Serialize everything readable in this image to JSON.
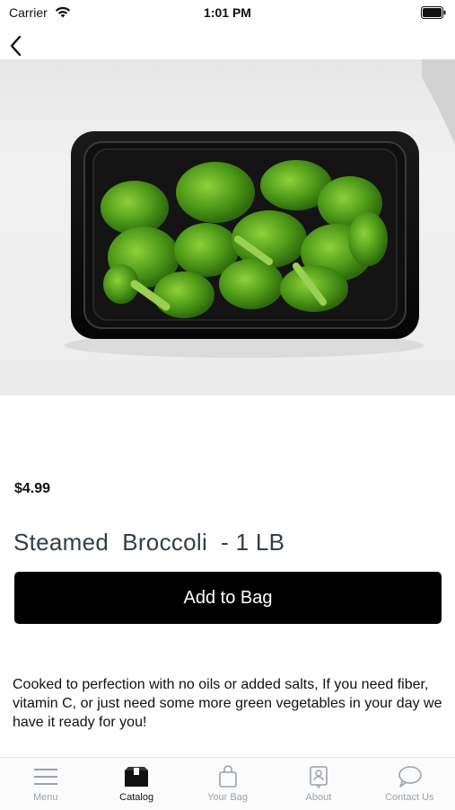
{
  "status_bar": {
    "carrier": "Carrier",
    "time": "1:01 PM"
  },
  "product": {
    "image_icon": "steamed-broccoli-photo",
    "price": "$4.99",
    "title": "Steamed  Broccoli  - 1 LB",
    "add_button_label": "Add to Bag",
    "description": "Cooked to perfection with no oils or added salts, If you need fiber, vitamin C, or just need some more green vegetables in your day we have it ready for you!"
  },
  "tab_bar": {
    "tabs": [
      {
        "label": "Menu",
        "icon": "menu-icon",
        "active": false
      },
      {
        "label": "Catalog",
        "icon": "catalog-icon",
        "active": true
      },
      {
        "label": "Your Bag",
        "icon": "bag-icon",
        "active": false
      },
      {
        "label": "About",
        "icon": "about-icon",
        "active": false
      },
      {
        "label": "Contact Us",
        "icon": "contact-icon",
        "active": false
      }
    ]
  },
  "colors": {
    "accent_button": "#000000",
    "title_text": "#333e48",
    "tab_inactive": "#9aa2aa",
    "tab_active": "#111111"
  }
}
